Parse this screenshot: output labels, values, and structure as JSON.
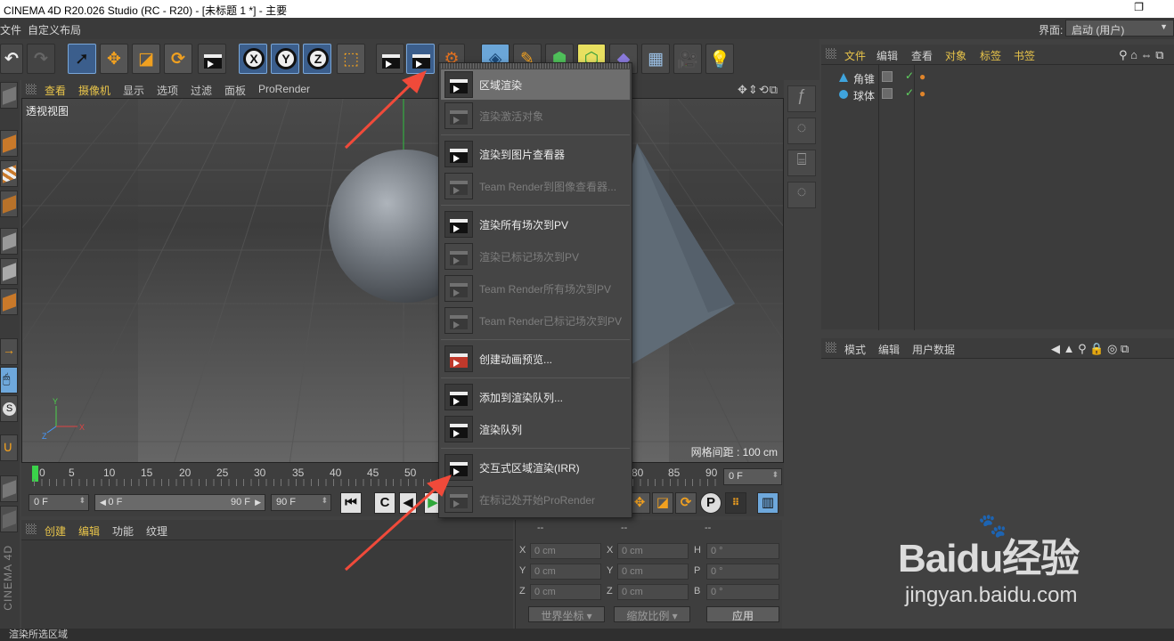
{
  "window": {
    "title": "CINEMA 4D R20.026 Studio (RC - R20) - [未标题 1 *] - 主要",
    "restore_glyph": "❐"
  },
  "menubar": {
    "items": [
      "文件",
      "自定义布局"
    ],
    "layout_label": "界面:",
    "layout_value": "启动 (用户)"
  },
  "viewport": {
    "menu": [
      "查看",
      "摄像机",
      "显示",
      "选项",
      "过滤",
      "面板",
      "ProRender"
    ],
    "view_label": "透视视图",
    "grid_info": "网格间距 : 100 cm",
    "nav_icons": "✥⇕⟲⧉"
  },
  "timeline": {
    "ticks": [
      "0",
      "5",
      "10",
      "15",
      "20",
      "25",
      "30",
      "35",
      "40",
      "45",
      "50",
      "80",
      "85",
      "90"
    ],
    "current_frame": "0 F",
    "start_field": "0 F",
    "range_start": "0 F",
    "range_end": "90 F",
    "end_field": "90 F"
  },
  "material_manager": {
    "menu": [
      "创建",
      "编辑",
      "功能",
      "纹理"
    ]
  },
  "coordinates": {
    "headers": [
      "--",
      "--",
      "--"
    ],
    "rows": [
      {
        "l1": "X",
        "v1": "0 cm",
        "l2": "X",
        "v2": "0 cm",
        "l3": "H",
        "v3": "0 °"
      },
      {
        "l1": "Y",
        "v1": "0 cm",
        "l2": "Y",
        "v2": "0 cm",
        "l3": "P",
        "v3": "0 °"
      },
      {
        "l1": "Z",
        "v1": "0 cm",
        "l2": "Z",
        "v2": "0 cm",
        "l3": "B",
        "v3": "0 °"
      }
    ],
    "world_coord": "世界坐标",
    "scale_mode": "缩放比例",
    "apply": "应用"
  },
  "object_manager": {
    "menu": [
      "文件",
      "编辑",
      "查看",
      "对象",
      "标签",
      "书签"
    ],
    "objects": [
      {
        "name": "角锥",
        "icon_color": "#4ea3dc"
      },
      {
        "name": "球体",
        "icon_color": "#4ea3dc"
      }
    ]
  },
  "attribute_manager": {
    "menu": [
      "模式",
      "编辑",
      "用户数据"
    ]
  },
  "render_menu": {
    "items": [
      {
        "label": "区域渲染",
        "enabled": true,
        "highlight": true
      },
      {
        "label": "渲染激活对象",
        "enabled": false
      },
      {
        "label": "渲染到图片查看器",
        "enabled": true
      },
      {
        "label": "Team Render到图像查看器...",
        "enabled": false
      },
      {
        "label": "渲染所有场次到PV",
        "enabled": true
      },
      {
        "label": "渲染已标记场次到PV",
        "enabled": false
      },
      {
        "label": "Team Render所有场次到PV",
        "enabled": false
      },
      {
        "label": "Team Render已标记场次到PV",
        "enabled": false
      },
      {
        "label": "创建动画预览...",
        "enabled": true
      },
      {
        "label": "添加到渲染队列...",
        "enabled": true
      },
      {
        "label": "渲染队列",
        "enabled": true
      },
      {
        "label": "交互式区域渲染(IRR)",
        "enabled": true
      },
      {
        "label": "在标记处开始ProRender",
        "enabled": false
      }
    ]
  },
  "status_bar": {
    "text": "渲染所选区域"
  },
  "colors": {
    "accent_highlight": "#6e6e6e",
    "annotation_arrow": "#f04a3a",
    "play_head": "#3ad34a",
    "tag_orange": "#e0852b"
  },
  "watermark": {
    "logo": "Baidu经验",
    "url": "jingyan.baidu.com"
  }
}
